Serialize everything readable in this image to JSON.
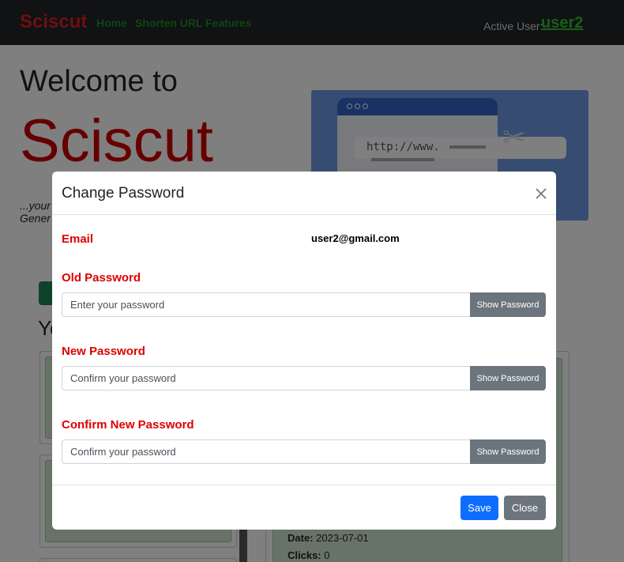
{
  "navbar": {
    "brand": "Sciscut",
    "links": [
      "Home",
      "Shorten URL",
      "Features"
    ],
    "active_user_label": "Active User:",
    "active_user": "user2"
  },
  "hero": {
    "welcome": "Welcome to",
    "name": "Sciscut",
    "tagline_line1": "...your",
    "tagline_line2": "Gener",
    "url_text": "http://www.",
    "your_prefix": "Yo"
  },
  "card": {
    "date_label": "Date:",
    "date_value": "2023-07-01",
    "clicks_label": "Clicks:",
    "clicks_value": "0"
  },
  "modal": {
    "title": "Change Password",
    "email_label": "Email",
    "email_value": "user2@gmail.com",
    "old_password_label": "Old Password",
    "old_password_placeholder": "Enter your password",
    "new_password_label": "New Password",
    "new_password_placeholder": "Confirm your password",
    "confirm_password_label": "Confirm New Password",
    "confirm_password_placeholder": "Confirm your password",
    "show_password_label": "Show Password",
    "save_label": "Save",
    "close_label": "Close"
  },
  "colors": {
    "brand": "#dc1f1f",
    "nav_link": "#1f8a1f",
    "label_red": "#e00000",
    "primary": "#0d6efd",
    "secondary": "#6c757d"
  }
}
